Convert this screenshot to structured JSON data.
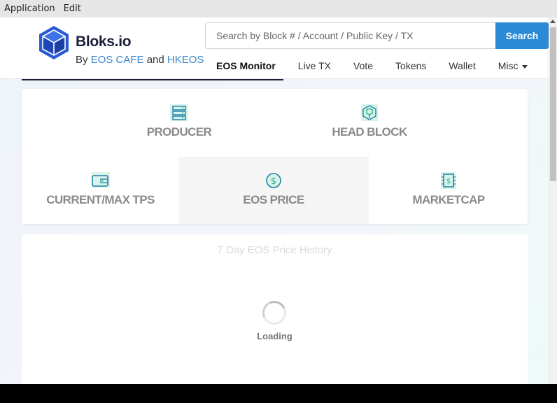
{
  "menubar": {
    "items": [
      "Application",
      "Edit"
    ]
  },
  "header": {
    "brand": "Bloks.io",
    "by_prefix": "By",
    "partner1": "EOS CAFE",
    "and_word": "and",
    "partner2": "HKEOS",
    "search_placeholder": "Search by Block # / Account / Public Key / TX",
    "search_button": "Search",
    "nav": [
      "EOS Monitor",
      "Live TX",
      "Vote",
      "Tokens",
      "Wallet",
      "Misc"
    ],
    "active_tab": "EOS Monitor"
  },
  "stats": {
    "producer": "PRODUCER",
    "head_block": "HEAD BLOCK",
    "tps": "CURRENT/MAX TPS",
    "price": "EOS PRICE",
    "marketcap": "MARKETCAP"
  },
  "chart": {
    "title": "7 Day EOS Price History",
    "loading": "Loading"
  },
  "colors": {
    "accent": "#2b8ad6",
    "brand_dark": "#1b1f3b",
    "icon_green": "#1db48a",
    "link": "#3a87c8"
  },
  "icons": [
    "cube-logo-icon",
    "server-icon",
    "hexagon-network-icon",
    "wallet-icon",
    "dollar-coin-icon",
    "money-chip-icon",
    "spinner-icon",
    "caret-down-icon"
  ]
}
